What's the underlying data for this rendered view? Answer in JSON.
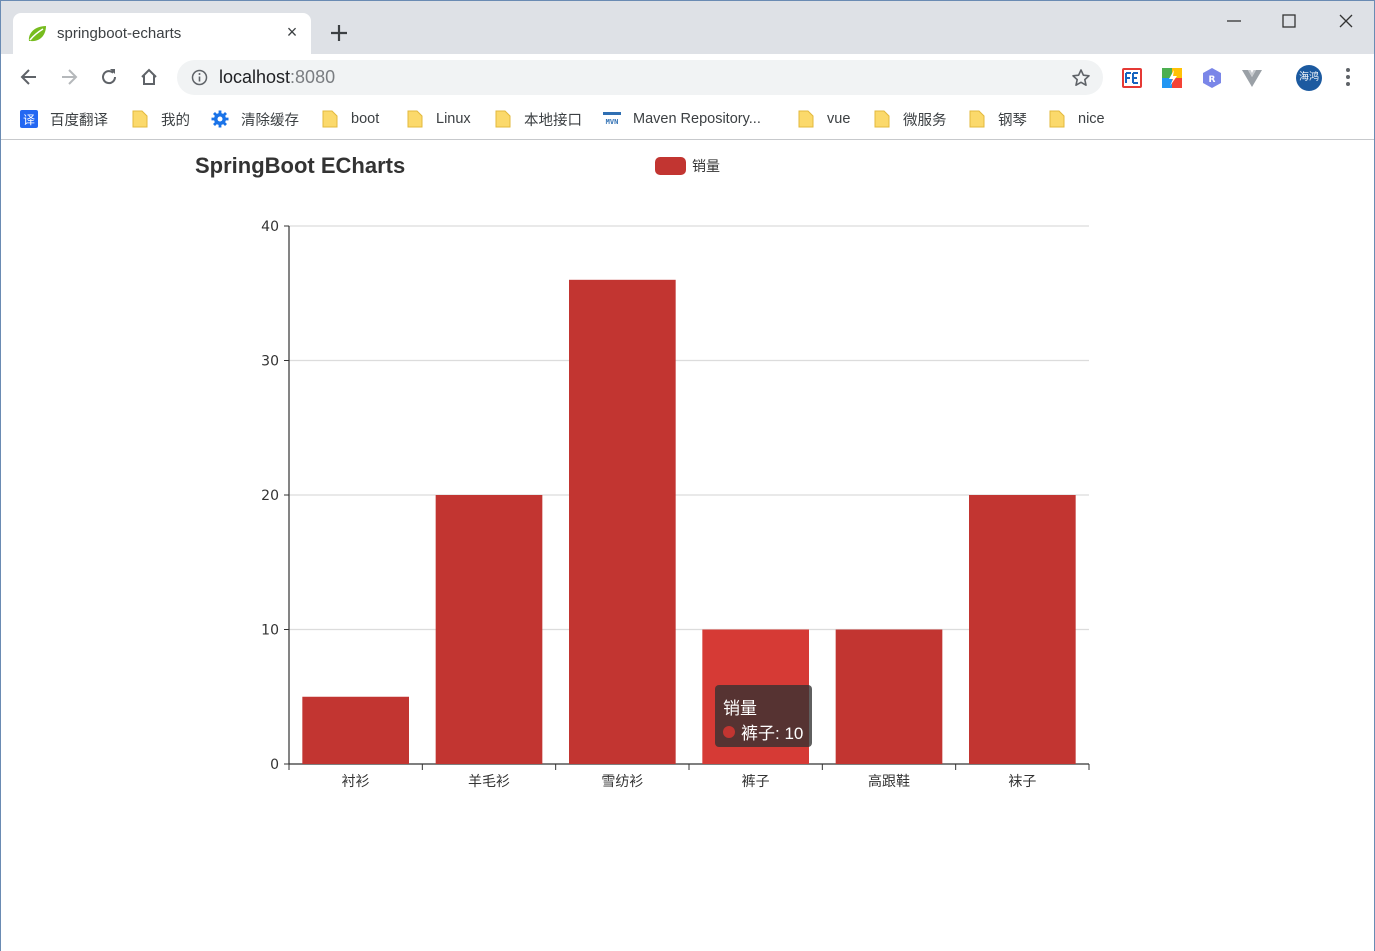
{
  "browser": {
    "tab": {
      "title": "springboot-echarts",
      "close_glyph": "×"
    },
    "address": {
      "host": "localhost",
      "port": ":8080"
    },
    "profile_label": "海鸿",
    "bookmarks": [
      {
        "label": "百度翻译",
        "icon": "translate-icon"
      },
      {
        "label": "我的",
        "icon": "folder-icon"
      },
      {
        "label": "清除缓存",
        "icon": "gear-icon"
      },
      {
        "label": "boot",
        "icon": "folder-icon"
      },
      {
        "label": "Linux",
        "icon": "folder-icon"
      },
      {
        "label": "本地接口",
        "icon": "folder-icon"
      },
      {
        "label": "Maven Repository...",
        "icon": "mvn-icon"
      },
      {
        "label": "vue",
        "icon": "folder-icon"
      },
      {
        "label": "微服务",
        "icon": "folder-icon"
      },
      {
        "label": "钢琴",
        "icon": "folder-icon"
      },
      {
        "label": "nice",
        "icon": "folder-icon"
      }
    ],
    "extensions": [
      "fe-helper-icon",
      "color-picker-icon",
      "r-extension-icon",
      "vue-devtools-icon"
    ]
  },
  "colors": {
    "bar": "#c23531",
    "bar_highlight": "#d63a35",
    "tab_strip": "#dee1e6"
  },
  "chart_data": {
    "type": "bar",
    "title": "SpringBoot ECharts",
    "legend": [
      "销量"
    ],
    "legend_position": "top-center",
    "categories": [
      "衬衫",
      "羊毛衫",
      "雪纺衫",
      "裤子",
      "高跟鞋",
      "袜子"
    ],
    "series": [
      {
        "name": "销量",
        "values": [
          5,
          20,
          36,
          10,
          10,
          20
        ]
      }
    ],
    "ylim": [
      0,
      40
    ],
    "yticks": [
      0,
      10,
      20,
      30,
      40
    ],
    "grid": true,
    "highlighted_category": "裤子"
  },
  "tooltip": {
    "series": "销量",
    "text": "裤子: 10"
  }
}
